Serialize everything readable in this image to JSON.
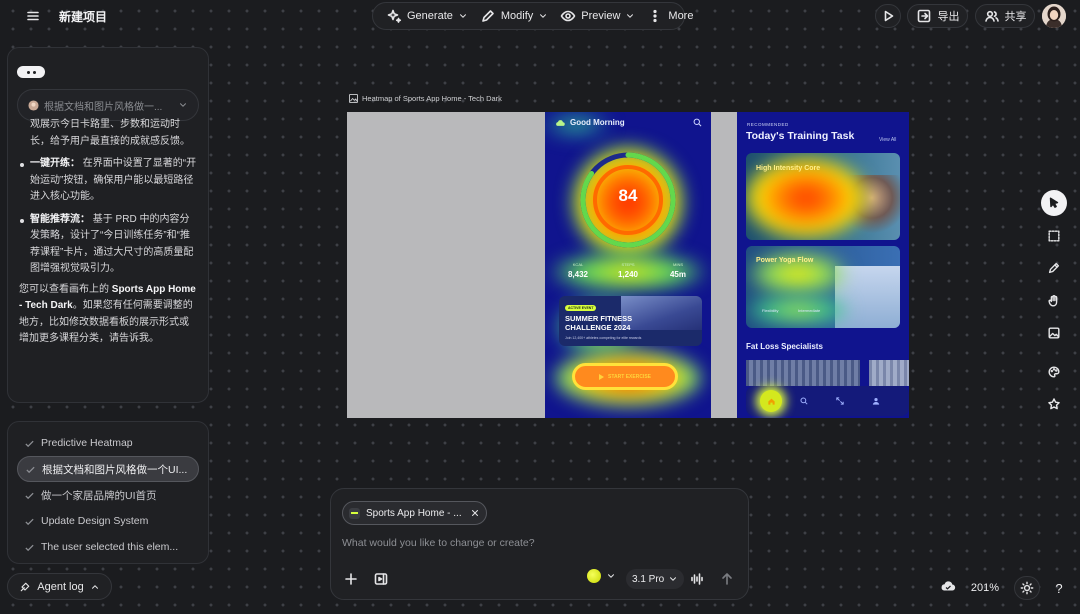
{
  "header": {
    "project_title": "新建项目",
    "toolbar": {
      "generate": "Generate",
      "modify": "Modify",
      "preview": "Preview",
      "more": "More"
    },
    "export_label": "导出",
    "share_label": "共享"
  },
  "chat": {
    "context_select_value": "根据文档和图片风格做一...",
    "paragraphs": {
      "cut_line": "观展示今日卡路里、步数和运动时",
      "cut_rest": "长，给予用户最直接的成就感反馈。",
      "bullet1_title": "一键开练：",
      "bullet1_text": "在界面中设置了显著的“开始运动”按钮，确保用户能以最短路径进入核心功能。",
      "bullet2_title": "智能推荐流：",
      "bullet2_text": "基于 PRD 中的内容分发策略，设计了“今日训练任务”和“推荐课程”卡片，通过大尺寸的高质量配图增强视觉吸引力。",
      "summary_pre": "您可以查看画布上的",
      "summary_bold": "Sports App Home - Tech Dark",
      "summary_post": "。如果您有任何需要调整的地方，比如修改数据看板的展示形式或增加更多课程分类，请告诉我。"
    }
  },
  "tasks": [
    {
      "label": "Predictive Heatmap",
      "active": false
    },
    {
      "label": "根据文档和图片风格做一个UI...",
      "active": true
    },
    {
      "label": "做一个家居品牌的UI首页",
      "active": false
    },
    {
      "label": "Update Design System",
      "active": false
    },
    {
      "label": "The user selected this elem...",
      "active": false
    }
  ],
  "agent_log_label": "Agent log",
  "canvas": {
    "frame_label": "Heatmap of Sports App Home - Tech Dark",
    "screen_a": {
      "greeting": "Good Morning",
      "score": "84",
      "stats": [
        {
          "label": "KCAL",
          "value": "8,432"
        },
        {
          "label": "STEPS",
          "value": "1,240"
        },
        {
          "label": "MINS",
          "value": "45m"
        }
      ],
      "challenge_badge": "ACTIVE EVENT",
      "challenge_title": "SUMMER FITNESS CHALLENGE 2024",
      "challenge_sub": "Join 12,400+ athletes competing for elite rewards",
      "start_button": "START EXERCISE"
    },
    "screen_b": {
      "recommended_label": "RECOMMENDED",
      "title": "Today's Training Task",
      "view_all": "View All",
      "card1_title": "High Intensity Core",
      "card2_title": "Power Yoga Flow",
      "card2_tag1": "Flexibility",
      "card2_tag2": "Intermediate",
      "section_title": "Fat Loss Specialists"
    }
  },
  "composer": {
    "context_chip": "Sports App Home - ...",
    "placeholder": "What would you like to change or create?",
    "model": "3.1 Pro"
  },
  "zoom_level": "201%",
  "help_label": "?",
  "colors": {
    "background": "#1b1c1f",
    "panel": "#1f2023",
    "screen_bg": "#10148e",
    "accent_lime": "#d8ff3c"
  }
}
